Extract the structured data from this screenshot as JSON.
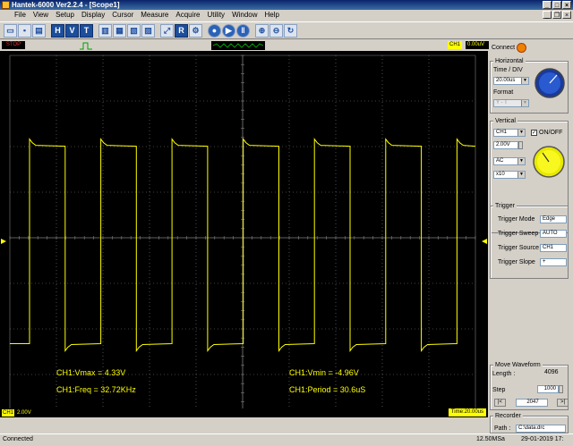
{
  "window": {
    "title": "Hantek-6000 Ver2.2.4 - [Scope1]"
  },
  "menu": [
    "File",
    "View",
    "Setup",
    "Display",
    "Cursor",
    "Measure",
    "Acquire",
    "Utility",
    "Window",
    "Help"
  ],
  "toolbar": {
    "letter_buttons": [
      "H",
      "V",
      "T"
    ],
    "auto_button": "R"
  },
  "status": {
    "run_state": "STOP",
    "channel": "CH1",
    "trigger_level": "0.00uV"
  },
  "scope": {
    "trace_color": "#ffff00",
    "grid_color": "#808080",
    "measurements": {
      "vmax": "CH1:Vmax = 4.33V",
      "freq": "CH1:Freq = 32.72KHz",
      "vmin": "CH1:Vmin = -4.96V",
      "period": "CH1:Period = 30.6uS"
    },
    "bottom": {
      "channel_label": "CH1",
      "volts_div": "2.00V",
      "timebase": "Time:20.00us"
    }
  },
  "panel": {
    "connect_label": "Connect",
    "horizontal": {
      "title": "Horizontal",
      "time_div_label": "Time / DIV",
      "time_div": "20.00us",
      "format_label": "Format",
      "format": "Y - T"
    },
    "vertical": {
      "title": "Vertical",
      "channel": "CH1",
      "on_off_label": "ON/OFF",
      "volts": "2.00V",
      "coupling": "AC",
      "probe": "x10"
    },
    "trigger": {
      "title": "Trigger",
      "mode_label": "Trigger Mode",
      "mode": "Edge",
      "sweep_label": "Trigger Sweep",
      "sweep": "AUTO",
      "source_label": "Trigger Source",
      "source": "CH1",
      "slope_label": "Trigger Slope",
      "slope": "+"
    },
    "move_waveform": {
      "title": "Move Waveform",
      "length_label": "Length :",
      "length": "4096",
      "step_label": "Step",
      "step": "1000",
      "prev": "|<",
      "position": "2047",
      "next": ">|"
    },
    "recorder": {
      "title": "Recorder",
      "path_label": "Path :",
      "path": "C:\\data.drc"
    }
  },
  "statusbar": {
    "left": "Connected",
    "sample_rate": "12.50MSa",
    "datetime": "29-01-2019  17:"
  }
}
